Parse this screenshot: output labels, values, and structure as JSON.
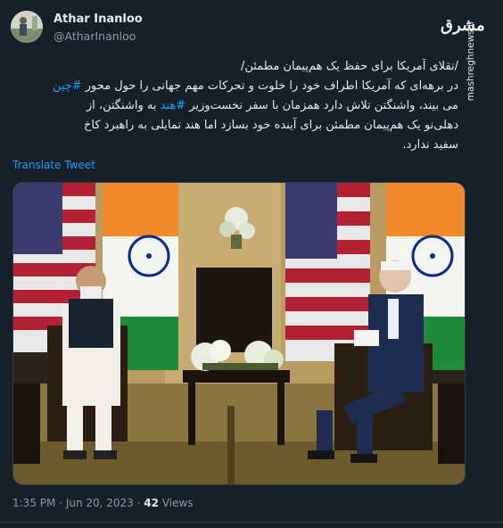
{
  "author": {
    "name": "Athar Inanloo",
    "handle": "@AtharInanloo"
  },
  "watermark": {
    "logo_text": "مشرق",
    "site": "mashreghnews.ir"
  },
  "tweet": {
    "lines": [
      "/تقلای آمریکا برای حفظ یک هم‌پیمان مطمئن/",
      "در برهه‌ای که آمریکا اطراف خود را خلوت و تحرکات مهم جهانی را حول محور #چین",
      "می بیند، واشنگتن تلاش دارد همزمان با سفر نخست‌وزیر #هند به واشنگتن، از",
      "دهلی‌نو یک هم‌پیمان مطمئن برای آینده خود بسازد اما هند تمایلی به راهبرد کاخ",
      "سفید ندارد."
    ],
    "hashtags": [
      "#چین",
      "#هند"
    ],
    "translate_label": "Translate Tweet"
  },
  "meta": {
    "time": "1:35 PM",
    "separator": " · ",
    "date": "Jun 20, 2023",
    "views_count": "42",
    "views_label": "Views"
  },
  "colors": {
    "background": "#16202b",
    "text": "#e7e9ea",
    "secondary": "#8b98a5",
    "link": "#1d9bf0"
  }
}
